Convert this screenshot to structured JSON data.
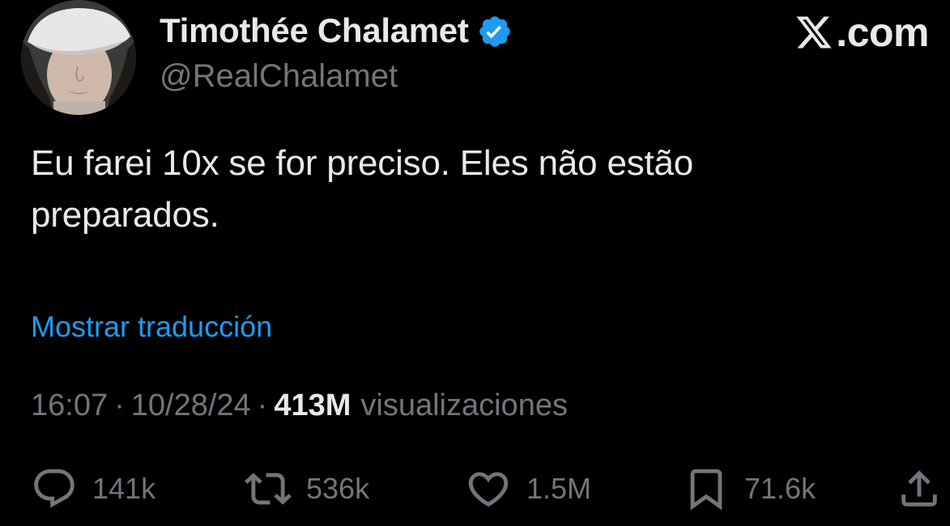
{
  "author": {
    "display_name": "Timothée Chalamet",
    "handle": "@RealChalamet",
    "verified": true
  },
  "brand": {
    "text": ".com"
  },
  "tweet": {
    "text": "Eu farei 10x se for preciso. Eles não estão preparados.",
    "translate_link": "Mostrar traducción"
  },
  "meta": {
    "time": "16:07",
    "separator": "·",
    "date": "10/28/24",
    "views_count": "413M",
    "views_label": "visualizaciones"
  },
  "actions": {
    "replies": "141k",
    "retweets": "536k",
    "likes": "1.5M",
    "bookmarks": "71.6k"
  },
  "icons": {
    "reply": "reply-bubble-icon",
    "retweet": "retweet-icon",
    "like": "heart-icon",
    "bookmark": "bookmark-icon",
    "share": "share-icon",
    "verified": "verified-badge-icon",
    "brand": "x-logo-icon"
  },
  "colors": {
    "background": "#000000",
    "primary_text": "#e7e9ea",
    "secondary_text": "#71767b",
    "link": "#1d9bf0",
    "verified_badge": "#1d9bf0"
  }
}
